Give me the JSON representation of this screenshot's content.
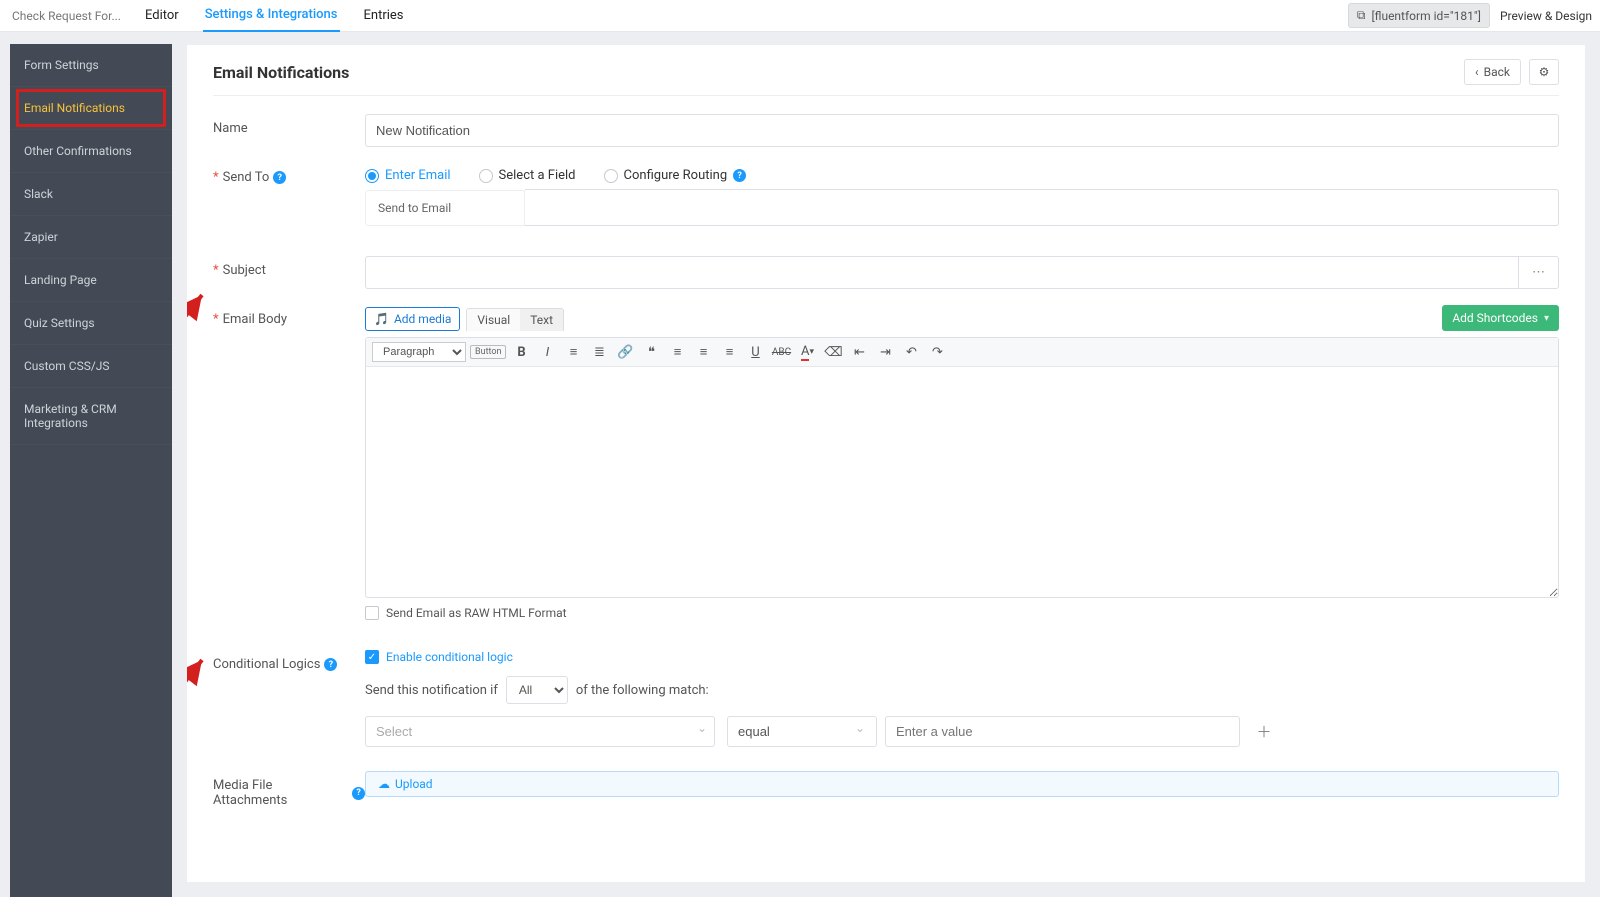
{
  "topbar": {
    "title": "Check Request For...",
    "tabs": {
      "editor": "Editor",
      "settings": "Settings & Integrations",
      "entries": "Entries"
    },
    "shortcode": "[fluentform id=\"181\"]",
    "preview": "Preview & Design"
  },
  "sidebar": {
    "items": [
      "Form Settings",
      "Email Notifications",
      "Other Confirmations",
      "Slack",
      "Zapier",
      "Landing Page",
      "Quiz Settings",
      "Custom CSS/JS",
      "Marketing & CRM Integrations"
    ]
  },
  "page": {
    "title": "Email Notifications",
    "back": "Back"
  },
  "form": {
    "name_label": "Name",
    "name_value": "New Notification",
    "sendto_label": "Send To",
    "sendto_options": {
      "enter": "Enter Email",
      "field": "Select a Field",
      "routing": "Configure Routing"
    },
    "send_email_label": "Send to Email",
    "subject_label": "Subject",
    "body_label": "Email Body",
    "add_media": "Add media",
    "vt_visual": "Visual",
    "vt_text": "Text",
    "shortcodes": "Add Shortcodes",
    "para": "Paragraph",
    "button_chip": "Button",
    "raw_html": "Send Email as RAW HTML Format"
  },
  "conditional": {
    "label": "Conditional Logics",
    "enable": "Enable conditional logic",
    "prefix": "Send this notification if",
    "match_sel": "All",
    "suffix": "of the following match:",
    "field_ph": "Select",
    "op": "equal",
    "val_ph": "Enter a value"
  },
  "attachments": {
    "label": "Media File Attachments",
    "upload": "Upload"
  }
}
